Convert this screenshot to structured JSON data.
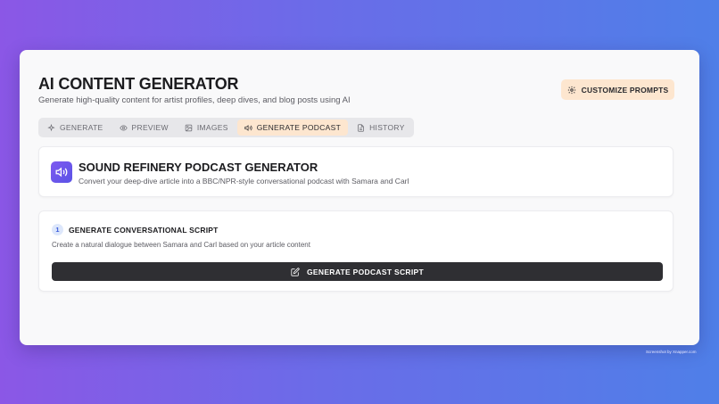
{
  "header": {
    "title": "AI CONTENT GENERATOR",
    "subtitle": "Generate high-quality content for artist profiles, deep dives, and blog posts using AI",
    "customize_label": "CUSTOMIZE PROMPTS",
    "customize_icon": "gear-icon"
  },
  "tabs": [
    {
      "label": "GENERATE",
      "icon": "sparkle-icon",
      "active": false
    },
    {
      "label": "PREVIEW",
      "icon": "eye-icon",
      "active": false
    },
    {
      "label": "IMAGES",
      "icon": "image-icon",
      "active": false
    },
    {
      "label": "GENERATE PODCAST",
      "icon": "speaker-icon",
      "active": true
    },
    {
      "label": "HISTORY",
      "icon": "document-icon",
      "active": false
    }
  ],
  "podcast": {
    "title": "SOUND REFINERY PODCAST GENERATOR",
    "description": "Convert your deep-dive article into a BBC/NPR-style conversational podcast with Samara and Carl"
  },
  "step": {
    "number": "1",
    "title": "GENERATE CONVERSATIONAL SCRIPT",
    "description": "Create a natural dialogue between Samara and Carl based on your article content",
    "button_label": "GENERATE PODCAST SCRIPT",
    "button_icon": "edit-icon"
  },
  "footer": {
    "note": "Screenshot by Xnapper.com"
  },
  "colors": {
    "accent_tab": "#fde6cf",
    "podcast_icon": "#6b55ec",
    "button_dark": "#2f2f33"
  }
}
